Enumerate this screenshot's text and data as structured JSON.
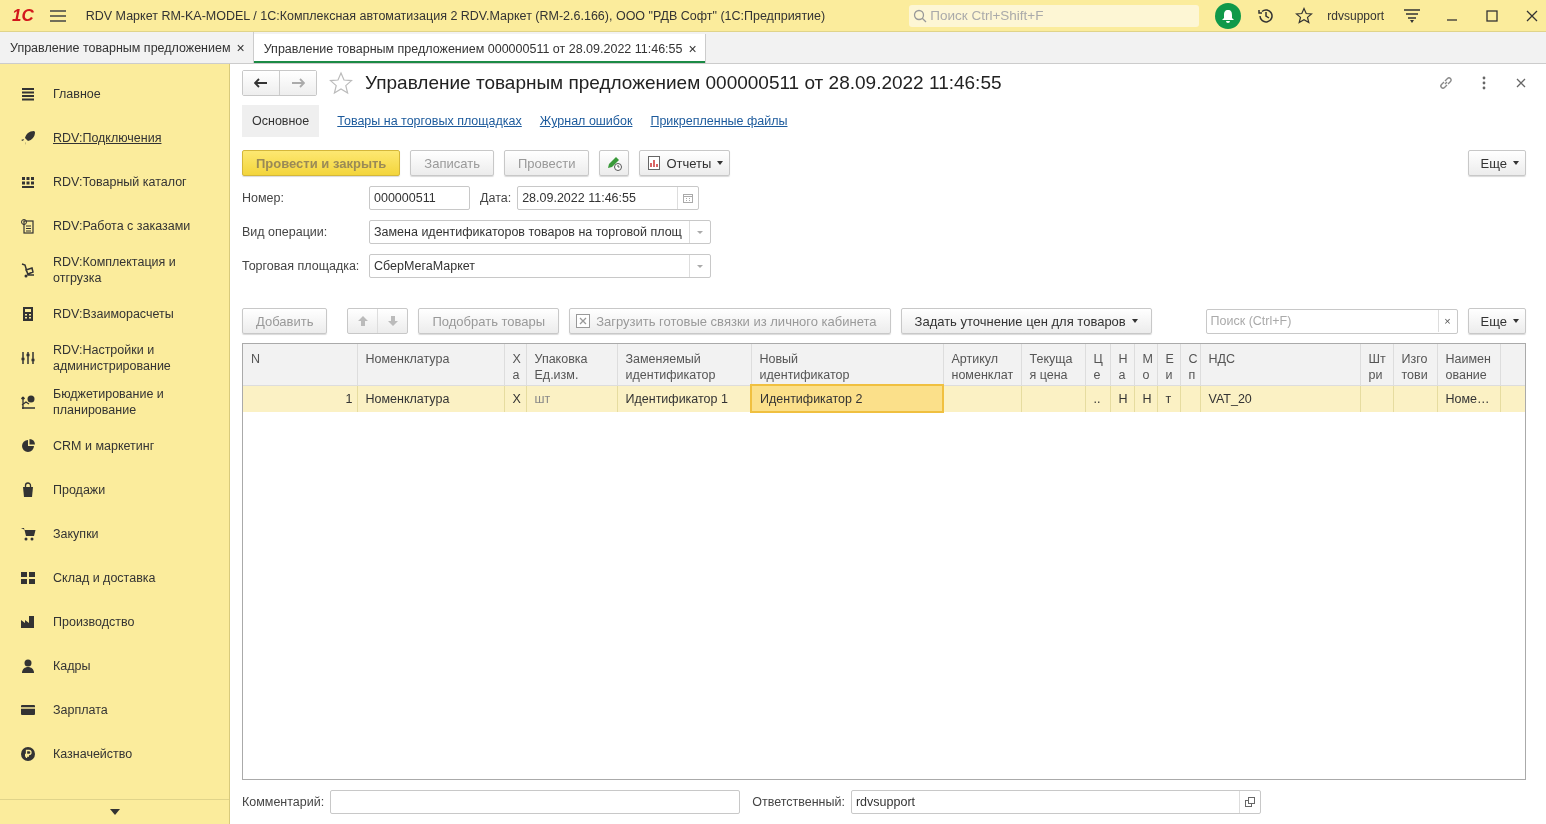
{
  "window": {
    "title": "RDV Маркет RM-KA-MODEL / 1С:Комплексная автоматизация 2 RDV.Маркет (RM-2.6.166), ООО \"РДВ Софт\"  (1С:Предприятие)",
    "logo": "1С",
    "search_placeholder": "Поиск Ctrl+Shift+F",
    "user": "rdvsupport"
  },
  "open_tabs": [
    {
      "label": "Управление товарным предложением",
      "close": "×",
      "selected": false
    },
    {
      "label": "Управление товарным предложением 000000511 от 28.09.2022 11:46:55",
      "close": "×",
      "selected": true
    }
  ],
  "sidebar": {
    "items": [
      {
        "label": "Главное",
        "hover": false
      },
      {
        "label": "RDV:Подключения",
        "hover": true
      },
      {
        "label": "RDV:Товарный каталог",
        "hover": false
      },
      {
        "label": "RDV:Работа с заказами",
        "hover": false
      },
      {
        "label": "RDV:Комплектация и отгрузка",
        "hover": false
      },
      {
        "label": "RDV:Взаиморасчеты",
        "hover": false
      },
      {
        "label": "RDV:Настройки и администрирование",
        "hover": false
      },
      {
        "label": "Бюджетирование и планирование",
        "hover": false
      },
      {
        "label": "CRM и маркетинг",
        "hover": false
      },
      {
        "label": "Продажи",
        "hover": false
      },
      {
        "label": "Закупки",
        "hover": false
      },
      {
        "label": "Склад и доставка",
        "hover": false
      },
      {
        "label": "Производство",
        "hover": false
      },
      {
        "label": "Кадры",
        "hover": false
      },
      {
        "label": "Зарплата",
        "hover": false
      },
      {
        "label": "Казначейство",
        "hover": false
      }
    ]
  },
  "form": {
    "title": "Управление товарным предложением 000000511 от 28.09.2022 11:46:55",
    "sections": [
      {
        "label": "Основное",
        "selected": true
      },
      {
        "label": "Товары на торговых площадках",
        "selected": false
      },
      {
        "label": "Журнал ошибок",
        "selected": false
      },
      {
        "label": "Прикрепленные файлы",
        "selected": false
      }
    ],
    "commands": [
      {
        "label": "Провести и закрыть",
        "kind": "default"
      },
      {
        "label": "Записать",
        "kind": "plain"
      },
      {
        "label": "Провести",
        "kind": "plain"
      },
      {
        "kind": "edit-icon"
      },
      {
        "label": "Отчеты",
        "kind": "menu"
      }
    ],
    "more": "Еще",
    "fields": {
      "number_label": "Номер:",
      "number": "000000511",
      "date_label": "Дата:",
      "date": "28.09.2022 11:46:55",
      "operation_label": "Вид операции:",
      "operation": "Замена идентификаторов товаров на торговой площ",
      "marketplace_label": "Торговая площадка:",
      "marketplace": "СберМегаМаркет"
    },
    "table_toolbar": {
      "add": "Добавить",
      "pick": "Подобрать товары",
      "load": "Загрузить готовые связки из личного кабинета",
      "prices": "Задать уточнение цен для товаров",
      "search_placeholder": "Поиск (Ctrl+F)",
      "clear": "×",
      "more": "Еще"
    },
    "table": {
      "columns": [
        "N",
        "Номенклатура",
        "Х\nа",
        "Упаковка\nЕд.изм.",
        "Заменяемый\nидентификатор",
        "Новый\nидентификатор",
        "Артикул\nноменклат",
        "Текуща\nя цена",
        "Ц\nе",
        "Н\nа",
        "М\nо",
        "Е\nи",
        "С\nп",
        "НДС",
        "Шт\nри",
        "Изго\nтови",
        "Наимен\nование"
      ],
      "rows": [
        {
          "selected": true,
          "cells": [
            "1",
            "Номенклатура",
            "Х",
            "шт",
            "Идентификатор 1",
            "Идентификатор 2",
            "",
            "",
            "..",
            "Н",
            "Н",
            "т",
            "",
            "VAT_20",
            "",
            "",
            "Номе…"
          ]
        }
      ]
    },
    "comment_label": "Комментарий:",
    "responsible_label": "Ответственный:",
    "responsible": "rdvsupport"
  }
}
